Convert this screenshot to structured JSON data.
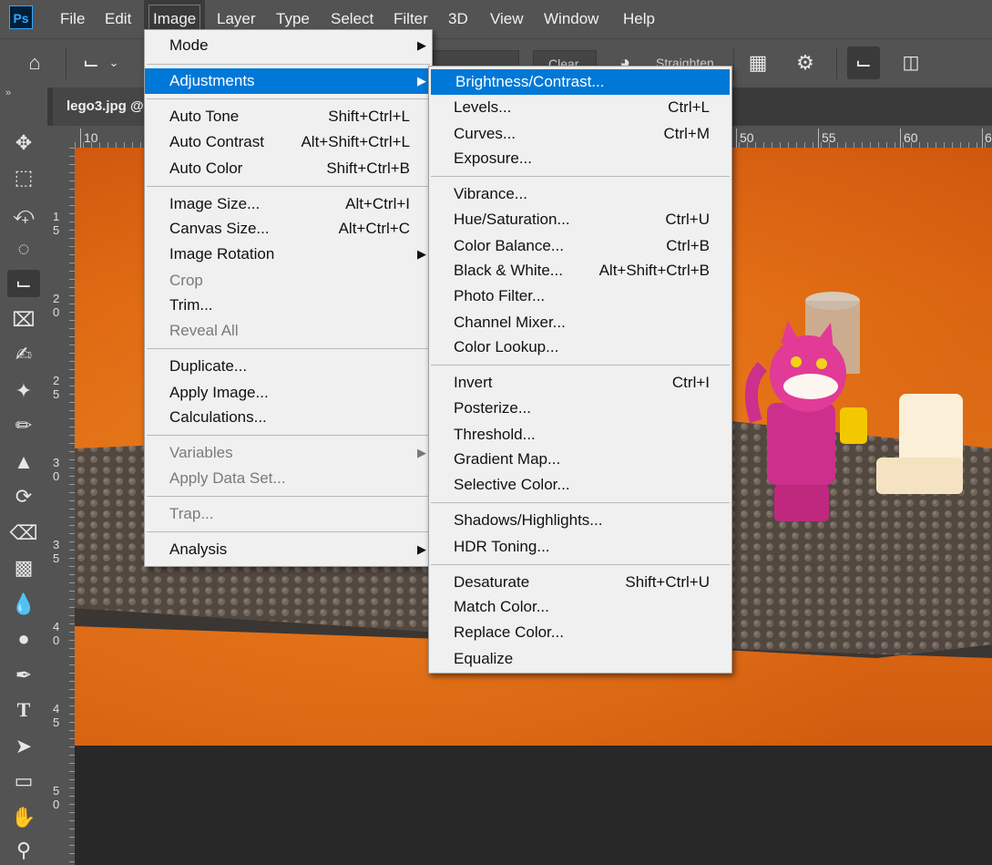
{
  "app": {
    "logo": "Ps"
  },
  "menubar": [
    "File",
    "Edit",
    "Image",
    "Layer",
    "Type",
    "Select",
    "Filter",
    "3D",
    "View",
    "Window",
    "Help"
  ],
  "options_bar": {
    "clear_label": "Clear",
    "straighten_label": "Straighten"
  },
  "document": {
    "tab_title": "lego3.jpg @"
  },
  "ruler": {
    "h_labels": [
      "10",
      "50",
      "55",
      "60",
      "6"
    ],
    "v_labels": [
      "1 5",
      "2 0",
      "2 5",
      "3 0",
      "3 5",
      "4 0",
      "4 5",
      "5 0"
    ]
  },
  "image_menu": {
    "items": [
      {
        "label": "Mode",
        "shortcut": "",
        "submenu": true,
        "disabled": false
      },
      {
        "label": "Adjustments",
        "shortcut": "",
        "submenu": true,
        "disabled": false,
        "highlighted": true
      },
      {
        "label": "Auto Tone",
        "shortcut": "Shift+Ctrl+L",
        "submenu": false,
        "disabled": false
      },
      {
        "label": "Auto Contrast",
        "shortcut": "Alt+Shift+Ctrl+L",
        "submenu": false,
        "disabled": false
      },
      {
        "label": "Auto Color",
        "shortcut": "Shift+Ctrl+B",
        "submenu": false,
        "disabled": false
      },
      {
        "label": "Image Size...",
        "shortcut": "Alt+Ctrl+I",
        "submenu": false,
        "disabled": false
      },
      {
        "label": "Canvas Size...",
        "shortcut": "Alt+Ctrl+C",
        "submenu": false,
        "disabled": false
      },
      {
        "label": "Image Rotation",
        "shortcut": "",
        "submenu": true,
        "disabled": false
      },
      {
        "label": "Crop",
        "shortcut": "",
        "submenu": false,
        "disabled": true
      },
      {
        "label": "Trim...",
        "shortcut": "",
        "submenu": false,
        "disabled": false
      },
      {
        "label": "Reveal All",
        "shortcut": "",
        "submenu": false,
        "disabled": true
      },
      {
        "label": "Duplicate...",
        "shortcut": "",
        "submenu": false,
        "disabled": false
      },
      {
        "label": "Apply Image...",
        "shortcut": "",
        "submenu": false,
        "disabled": false
      },
      {
        "label": "Calculations...",
        "shortcut": "",
        "submenu": false,
        "disabled": false
      },
      {
        "label": "Variables",
        "shortcut": "",
        "submenu": true,
        "disabled": true
      },
      {
        "label": "Apply Data Set...",
        "shortcut": "",
        "submenu": false,
        "disabled": true
      },
      {
        "label": "Trap...",
        "shortcut": "",
        "submenu": false,
        "disabled": true
      },
      {
        "label": "Analysis",
        "shortcut": "",
        "submenu": true,
        "disabled": false
      }
    ]
  },
  "adjustments_menu": {
    "items": [
      {
        "label": "Brightness/Contrast...",
        "shortcut": "",
        "highlighted": true
      },
      {
        "label": "Levels...",
        "shortcut": "Ctrl+L"
      },
      {
        "label": "Curves...",
        "shortcut": "Ctrl+M"
      },
      {
        "label": "Exposure...",
        "shortcut": ""
      },
      {
        "label": "Vibrance...",
        "shortcut": ""
      },
      {
        "label": "Hue/Saturation...",
        "shortcut": "Ctrl+U"
      },
      {
        "label": "Color Balance...",
        "shortcut": "Ctrl+B"
      },
      {
        "label": "Black & White...",
        "shortcut": "Alt+Shift+Ctrl+B"
      },
      {
        "label": "Photo Filter...",
        "shortcut": ""
      },
      {
        "label": "Channel Mixer...",
        "shortcut": ""
      },
      {
        "label": "Color Lookup...",
        "shortcut": ""
      },
      {
        "label": "Invert",
        "shortcut": "Ctrl+I"
      },
      {
        "label": "Posterize...",
        "shortcut": ""
      },
      {
        "label": "Threshold...",
        "shortcut": ""
      },
      {
        "label": "Gradient Map...",
        "shortcut": ""
      },
      {
        "label": "Selective Color...",
        "shortcut": ""
      },
      {
        "label": "Shadows/Highlights...",
        "shortcut": ""
      },
      {
        "label": "HDR Toning...",
        "shortcut": ""
      },
      {
        "label": "Desaturate",
        "shortcut": "Shift+Ctrl+U"
      },
      {
        "label": "Match Color...",
        "shortcut": ""
      },
      {
        "label": "Replace Color...",
        "shortcut": ""
      },
      {
        "label": "Equalize",
        "shortcut": ""
      }
    ]
  },
  "colors": {
    "highlight": "#0078d7",
    "panel": "#535353",
    "menu_bg": "#f0f0f0",
    "workspace": "#282828"
  },
  "tools": [
    "move-icon",
    "marquee-icon",
    "lasso-icon",
    "quick-select-icon",
    "crop-icon",
    "frame-icon",
    "eyedropper-icon",
    "healing-icon",
    "brush-icon",
    "stamp-icon",
    "history-brush-icon",
    "eraser-icon",
    "gradient-icon",
    "blur-icon",
    "dodge-icon",
    "pen-icon",
    "type-icon",
    "path-select-icon",
    "rectangle-icon",
    "hand-icon",
    "zoom-icon"
  ]
}
